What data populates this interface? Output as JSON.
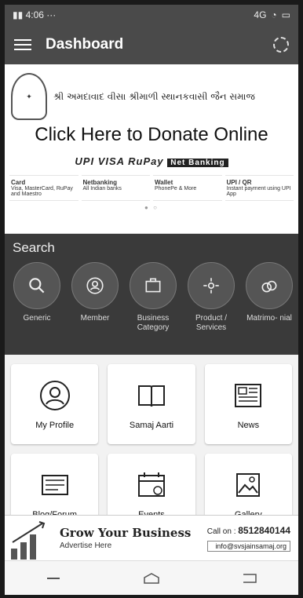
{
  "status": {
    "time": "4:06",
    "signal": "4G",
    "battery": ""
  },
  "appbar": {
    "title": "Dashboard"
  },
  "banner": {
    "org_text": "શ્રી અમદાવાદ વીસા શ્રીમાળી સ્થાનકવાસી જૈન સમાજ",
    "donate_text": "Click Here to Donate Online",
    "pay_logos": [
      "UPI",
      "VISA",
      "RuPay",
      "Net Banking"
    ],
    "pay_cards": [
      {
        "title": "Card",
        "sub": "Visa, MasterCard, RuPay and Maestro"
      },
      {
        "title": "Netbanking",
        "sub": "All Indian banks"
      },
      {
        "title": "Wallet",
        "sub": "PhonePe & More"
      },
      {
        "title": "UPI / QR",
        "sub": "Instant payment using UPI App"
      }
    ]
  },
  "search": {
    "title": "Search",
    "items": [
      {
        "label": "Generic",
        "icon": "search-icon"
      },
      {
        "label": "Member",
        "icon": "member-icon"
      },
      {
        "label": "Business Category",
        "icon": "briefcase-icon"
      },
      {
        "label": "Product / Services",
        "icon": "services-icon"
      },
      {
        "label": "Matrimo- nial",
        "icon": "rings-icon"
      }
    ]
  },
  "tiles": [
    {
      "label": "My Profile",
      "icon": "profile-icon"
    },
    {
      "label": "Samaj Aarti",
      "icon": "book-icon"
    },
    {
      "label": "News",
      "icon": "newspaper-icon"
    },
    {
      "label": "Blog/Forum",
      "icon": "blog-icon"
    },
    {
      "label": "Events",
      "icon": "calendar-icon"
    },
    {
      "label": "Gallery",
      "icon": "gallery-icon"
    }
  ],
  "ad": {
    "title": "Grow Your Business",
    "subtitle": "Advertise Here",
    "call_label": "Call on :",
    "phone": "8512840144",
    "website": "info@svsjainsamaj.org"
  },
  "colors": {
    "appbar": "#4a4a4a",
    "search_bg": "#3a3a3a",
    "page_bg": "#f2f2f2"
  }
}
